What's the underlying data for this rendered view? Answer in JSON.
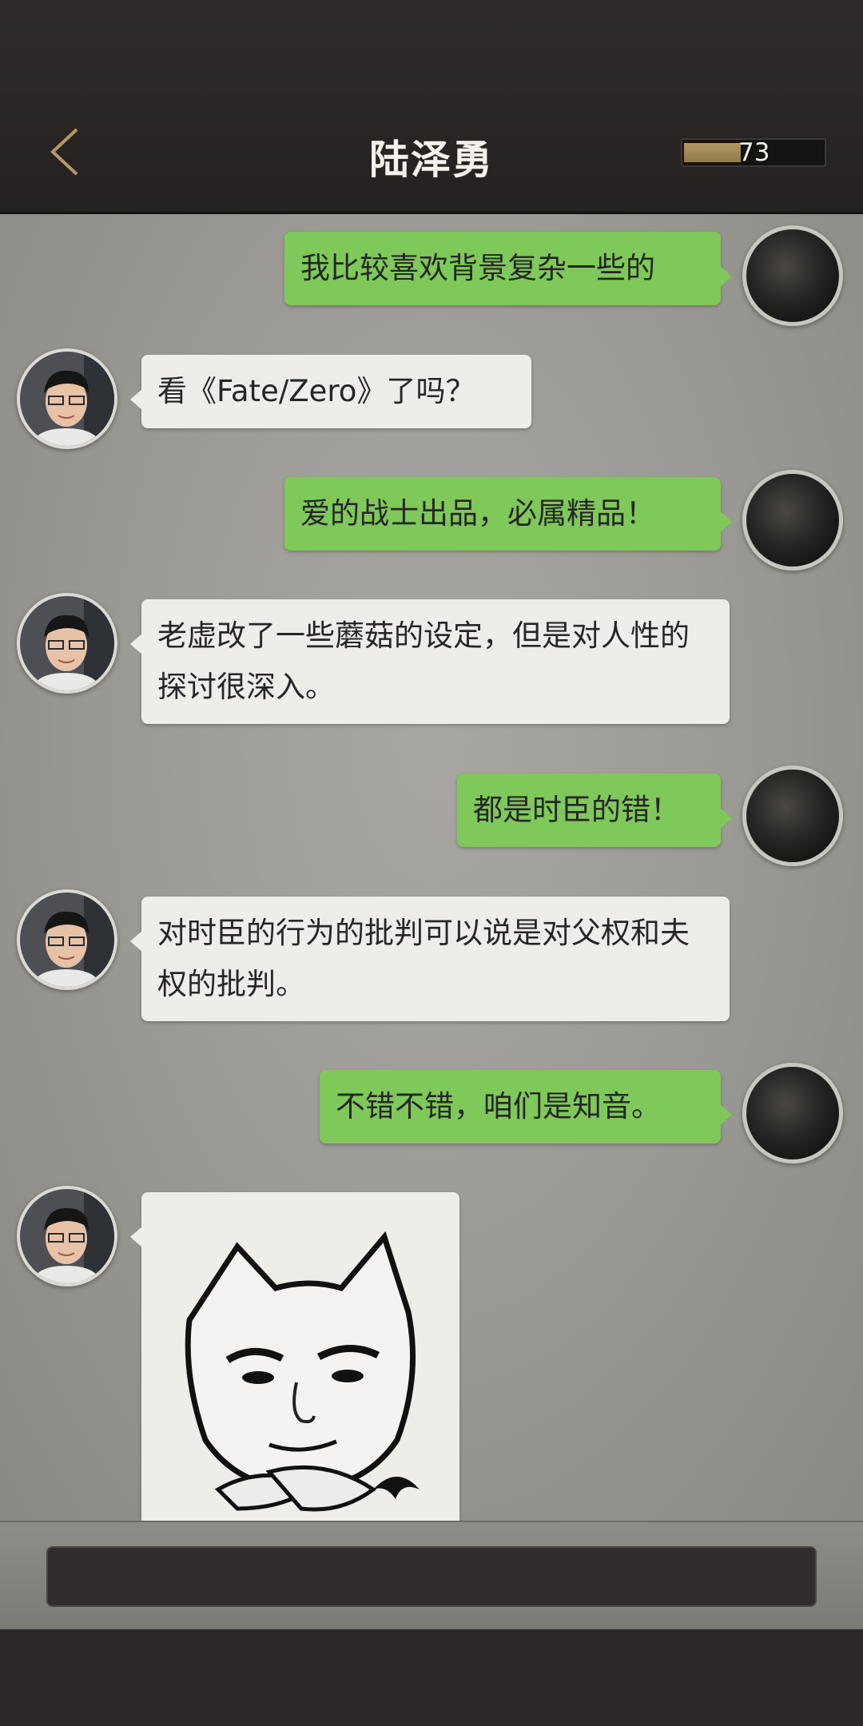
{
  "header": {
    "title": "陆泽勇",
    "energy_value": "73",
    "energy_fraction": 0.4
  },
  "messages": [
    {
      "side": "right",
      "text": "我比较喜欢背景复杂一些的"
    },
    {
      "side": "left",
      "text": "看《Fate/Zero》了吗？"
    },
    {
      "side": "right",
      "text": "爱的战士出品，必属精品！"
    },
    {
      "side": "left",
      "text": "老虚改了一些蘑菇的设定，但是对人性的探讨很深入。"
    },
    {
      "side": "right",
      "text": "都是时臣的错！"
    },
    {
      "side": "left",
      "text": "对时臣的行为的批判可以说是对父权和夫权的批判。"
    },
    {
      "side": "right",
      "text": "不错不错，咱们是知音。"
    },
    {
      "side": "left",
      "type": "sticker",
      "sticker": "cat-face-arms-crossed"
    }
  ],
  "input": {
    "value": ""
  },
  "colors": {
    "header_bg": "#2a2726",
    "my_bubble": "#7fc85a",
    "their_bubble": "#eeedea",
    "energy_fill": "#a48b57"
  },
  "icons": {
    "back": "chevron-left-icon"
  }
}
